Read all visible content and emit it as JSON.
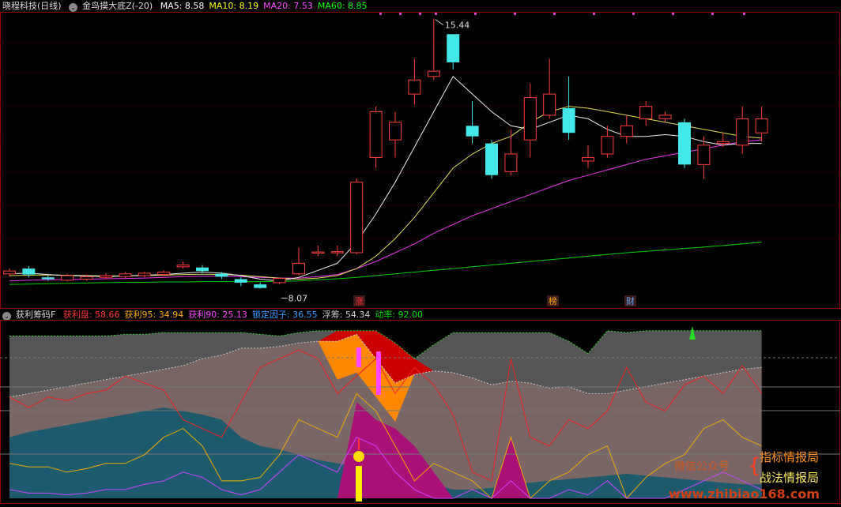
{
  "main_header": {
    "stock_name": "晓程科技",
    "period": "(日线)",
    "indicator_name": "金鸟摸大底Z(-20)",
    "ma": [
      {
        "label": "MA5:",
        "value": "8.58",
        "color": "#ffffff"
      },
      {
        "label": "MA10:",
        "value": "8.19",
        "color": "#ffff00"
      },
      {
        "label": "MA20:",
        "value": "7.53",
        "color": "#ff44ff"
      },
      {
        "label": "MA60:",
        "value": "8.85",
        "color": "#00ff00"
      }
    ]
  },
  "price_labels": {
    "high": "15.44",
    "low": "8.07"
  },
  "event_markers": [
    {
      "text": "涨",
      "color": "#ff3030"
    },
    {
      "text": "榜",
      "color": "#ffaa00"
    },
    {
      "text": "财",
      "color": "#66aaff"
    }
  ],
  "sub_header": {
    "indicator_name": "获利筹码F",
    "items": [
      {
        "label": "获利盘:",
        "value": "58.66",
        "color": "#ff3333"
      },
      {
        "label": "获利95:",
        "value": "34.94",
        "color": "#ffaa00"
      },
      {
        "label": "获利90:",
        "value": "25.13",
        "color": "#ff44ff"
      },
      {
        "label": "锁定因子:",
        "value": "36.55",
        "color": "#3399ff"
      },
      {
        "label": "浮筹:",
        "value": "54.34",
        "color": "#cccccc"
      },
      {
        "label": "动率:",
        "value": "92.00",
        "color": "#00dd00"
      }
    ]
  },
  "watermark": {
    "line1": "微信公众号",
    "brand1": "指标情报局",
    "brand2": "战法情报局",
    "url": "www.zhibiao168.com"
  },
  "chart_data": {
    "type": "candlestick",
    "candles": [
      {
        "o": 8.2,
        "c": 8.28,
        "h": 8.35,
        "l": 8.12
      },
      {
        "o": 8.35,
        "c": 8.18,
        "h": 8.42,
        "l": 8.1
      },
      {
        "o": 8.1,
        "c": 8.05,
        "h": 8.15,
        "l": 8.0
      },
      {
        "o": 8.02,
        "c": 8.15,
        "h": 8.2,
        "l": 7.98
      },
      {
        "o": 8.05,
        "c": 8.12,
        "h": 8.18,
        "l": 8.0
      },
      {
        "o": 8.1,
        "c": 8.15,
        "h": 8.22,
        "l": 8.05
      },
      {
        "o": 8.12,
        "c": 8.2,
        "h": 8.25,
        "l": 8.08
      },
      {
        "o": 8.15,
        "c": 8.22,
        "h": 8.26,
        "l": 8.1
      },
      {
        "o": 8.18,
        "c": 8.25,
        "h": 8.3,
        "l": 8.14
      },
      {
        "o": 8.4,
        "c": 8.45,
        "h": 8.55,
        "l": 8.35
      },
      {
        "o": 8.38,
        "c": 8.28,
        "h": 8.45,
        "l": 8.22
      },
      {
        "o": 8.2,
        "c": 8.12,
        "h": 8.25,
        "l": 8.05
      },
      {
        "o": 8.05,
        "c": 7.95,
        "h": 8.1,
        "l": 7.85
      },
      {
        "o": 7.9,
        "c": 7.8,
        "h": 7.95,
        "l": 7.78
      },
      {
        "o": 7.95,
        "c": 8.07,
        "h": 8.1,
        "l": 7.9
      },
      {
        "o": 8.2,
        "c": 8.5,
        "h": 8.95,
        "l": 8.15
      },
      {
        "o": 8.8,
        "c": 8.82,
        "h": 9.0,
        "l": 8.7
      },
      {
        "o": 8.8,
        "c": 8.83,
        "h": 9.0,
        "l": 8.7
      },
      {
        "o": 8.8,
        "c": 10.8,
        "h": 10.9,
        "l": 8.75
      },
      {
        "o": 11.5,
        "c": 12.8,
        "h": 12.95,
        "l": 11.2
      },
      {
        "o": 12.0,
        "c": 12.5,
        "h": 12.8,
        "l": 11.5
      },
      {
        "o": 13.3,
        "c": 13.7,
        "h": 14.3,
        "l": 13.0
      },
      {
        "o": 13.8,
        "c": 13.95,
        "h": 15.44,
        "l": 13.7
      },
      {
        "o": 15.0,
        "c": 14.2,
        "h": 15.0,
        "l": 14.0
      },
      {
        "o": 12.4,
        "c": 12.1,
        "h": 13.1,
        "l": 11.9
      },
      {
        "o": 11.9,
        "c": 11.0,
        "h": 12.0,
        "l": 10.9
      },
      {
        "o": 11.1,
        "c": 11.6,
        "h": 12.3,
        "l": 11.0
      },
      {
        "o": 12.0,
        "c": 13.2,
        "h": 13.6,
        "l": 11.5
      },
      {
        "o": 12.7,
        "c": 13.3,
        "h": 14.3,
        "l": 12.6
      },
      {
        "o": 12.9,
        "c": 12.2,
        "h": 13.8,
        "l": 12.0
      },
      {
        "o": 11.4,
        "c": 11.5,
        "h": 11.85,
        "l": 11.2
      },
      {
        "o": 11.6,
        "c": 12.1,
        "h": 12.4,
        "l": 11.5
      },
      {
        "o": 12.1,
        "c": 12.4,
        "h": 12.7,
        "l": 11.9
      },
      {
        "o": 12.6,
        "c": 12.95,
        "h": 13.1,
        "l": 12.4
      },
      {
        "o": 12.6,
        "c": 12.7,
        "h": 12.8,
        "l": 12.5
      },
      {
        "o": 12.5,
        "c": 11.3,
        "h": 12.6,
        "l": 11.2
      },
      {
        "o": 11.3,
        "c": 11.85,
        "h": 12.1,
        "l": 10.9
      },
      {
        "o": 11.9,
        "c": 11.95,
        "h": 12.2,
        "l": 11.8
      },
      {
        "o": 11.85,
        "c": 12.6,
        "h": 12.95,
        "l": 11.6
      },
      {
        "o": 12.2,
        "c": 12.6,
        "h": 12.95,
        "l": 11.95
      }
    ],
    "ma5": [
      8.2,
      8.22,
      8.18,
      8.15,
      8.14,
      8.12,
      8.14,
      8.16,
      8.18,
      8.22,
      8.25,
      8.22,
      8.15,
      8.05,
      8.0,
      8.1,
      8.3,
      8.5,
      9.1,
      9.9,
      10.8,
      11.8,
      12.8,
      13.8,
      13.3,
      12.8,
      12.4,
      12.3,
      12.5,
      12.7,
      12.6,
      12.3,
      12.1,
      12.1,
      12.15,
      12.1,
      11.95,
      11.85,
      11.9,
      11.9
    ],
    "ma10": [
      8.15,
      8.16,
      8.17,
      8.16,
      8.15,
      8.14,
      8.14,
      8.15,
      8.16,
      8.18,
      8.19,
      8.18,
      8.16,
      8.12,
      8.08,
      8.05,
      8.08,
      8.15,
      8.35,
      8.7,
      9.2,
      9.8,
      10.5,
      11.2,
      11.6,
      11.9,
      12.1,
      12.5,
      12.8,
      12.95,
      12.9,
      12.8,
      12.7,
      12.6,
      12.5,
      12.4,
      12.3,
      12.2,
      12.1,
      12.05
    ],
    "ma20": [
      8.0,
      8.02,
      8.03,
      8.04,
      8.05,
      8.06,
      8.07,
      8.08,
      8.1,
      8.12,
      8.13,
      8.13,
      8.12,
      8.1,
      8.08,
      8.08,
      8.12,
      8.18,
      8.35,
      8.55,
      8.8,
      9.05,
      9.35,
      9.6,
      9.85,
      10.05,
      10.25,
      10.45,
      10.65,
      10.85,
      11.0,
      11.15,
      11.3,
      11.45,
      11.55,
      11.65,
      11.75,
      11.85,
      11.95,
      12.0
    ],
    "ma60": [
      7.9,
      7.91,
      7.92,
      7.93,
      7.94,
      7.95,
      7.96,
      7.96,
      7.97,
      7.97,
      7.98,
      7.98,
      7.98,
      7.98,
      7.99,
      8.0,
      8.03,
      8.06,
      8.1,
      8.15,
      8.2,
      8.25,
      8.3,
      8.35,
      8.4,
      8.45,
      8.5,
      8.55,
      8.6,
      8.65,
      8.7,
      8.75,
      8.8,
      8.84,
      8.88,
      8.92,
      8.96,
      9.0,
      9.05,
      9.1
    ],
    "sub": {
      "top_dotted": [
        93,
        93,
        93,
        93,
        93,
        93,
        94,
        94,
        95,
        95,
        95,
        95,
        95,
        94,
        93,
        95,
        96,
        96,
        96,
        96,
        89,
        80,
        88,
        95,
        95,
        95,
        95,
        95,
        95,
        90,
        83,
        96,
        95,
        96,
        96,
        96,
        96,
        96,
        96,
        96
      ],
      "mid_dotted": [
        58,
        60,
        62,
        64,
        66,
        68,
        70,
        72,
        74,
        76,
        80,
        82,
        86,
        86,
        87,
        89,
        90,
        90,
        94,
        80,
        66,
        71,
        73,
        72,
        69,
        65,
        67,
        66,
        63,
        64,
        60,
        60,
        62,
        64,
        66,
        68,
        70,
        72,
        74,
        75
      ],
      "profit": [
        58,
        52,
        58,
        56,
        60,
        62,
        70,
        66,
        62,
        45,
        40,
        35,
        55,
        75,
        80,
        85,
        80,
        60,
        70,
        80,
        60,
        75,
        65,
        48,
        15,
        10,
        80,
        35,
        30,
        45,
        40,
        50,
        75,
        55,
        50,
        65,
        70,
        60,
        76,
        60
      ],
      "profit95": [
        20,
        18,
        18,
        15,
        17,
        20,
        20,
        25,
        35,
        40,
        30,
        10,
        10,
        12,
        25,
        45,
        40,
        35,
        60,
        50,
        30,
        10,
        20,
        15,
        10,
        0,
        35,
        0,
        10,
        15,
        25,
        30,
        0,
        12,
        20,
        25,
        40,
        45,
        35,
        30
      ],
      "profit90": [
        5,
        3,
        3,
        2,
        3,
        5,
        5,
        8,
        10,
        15,
        12,
        5,
        2,
        5,
        15,
        25,
        20,
        15,
        35,
        30,
        15,
        5,
        0,
        0,
        5,
        0,
        10,
        0,
        0,
        5,
        2,
        10,
        0,
        0,
        0,
        5,
        10,
        15,
        10,
        5
      ],
      "lock_fill": [
        35,
        38,
        40,
        42,
        44,
        46,
        48,
        50,
        52,
        50,
        48,
        45,
        35,
        30,
        28,
        25,
        22,
        20,
        18,
        15,
        12,
        10,
        8,
        5,
        5,
        6,
        7,
        9,
        10,
        11,
        12,
        13,
        14,
        13,
        12,
        11,
        10,
        9,
        8,
        8
      ],
      "magenta_fill": [
        0,
        0,
        0,
        0,
        0,
        0,
        0,
        0,
        0,
        0,
        0,
        0,
        0,
        0,
        0,
        0,
        0,
        0,
        55,
        45,
        40,
        30,
        15,
        0,
        0,
        0,
        35,
        0,
        0,
        0,
        0,
        0,
        0,
        0,
        0,
        0,
        0,
        0,
        0,
        0
      ]
    }
  }
}
